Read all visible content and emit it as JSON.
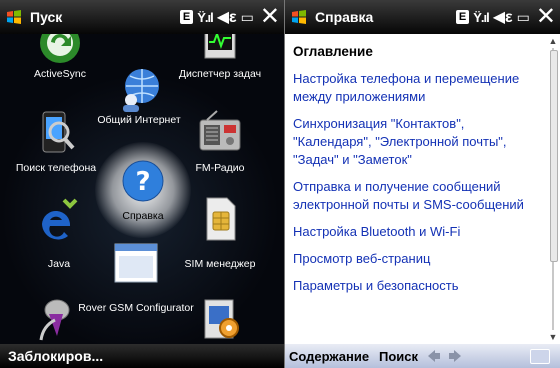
{
  "left_screen": {
    "title": "Пуск",
    "status": {
      "carrier_badge": "E",
      "close_glyph": "✕"
    },
    "apps": [
      {
        "label": "ActiveSync",
        "icon": "activesync-icon"
      },
      {
        "label": "Диспетчер задач",
        "icon": "task-manager-icon"
      },
      {
        "label": "Общий Интернет",
        "icon": "internet-sharing-icon"
      },
      {
        "label": "Поиск телефона",
        "icon": "search-phone-icon"
      },
      {
        "label": "FM-Радио",
        "icon": "fm-radio-icon"
      },
      {
        "label": "Справка",
        "icon": "help-icon"
      },
      {
        "label": "Java",
        "icon": "java-icon"
      },
      {
        "label": "SIM менеджер",
        "icon": "sim-manager-icon"
      },
      {
        "label": "Rover GSM Configurator",
        "icon": "rover-gsm-icon"
      },
      {
        "label": "",
        "icon": "microphone-icon"
      },
      {
        "label": "",
        "icon": "settings-icon"
      }
    ],
    "bottom_left": "Заблокиров..."
  },
  "right_screen": {
    "title": "Справка",
    "status": {
      "carrier_badge": "E",
      "close_glyph": "✕"
    },
    "heading": "Оглавление",
    "links": [
      "Настройка телефона и перемещение между приложениями",
      "Синхронизация \"Контактов\", \"Календаря\", \"Электронной почты\", \"Задач\" и \"Заметок\"",
      "Отправка и получение сообщений электронной почты и SMS-сообщений",
      "Настройка Bluetooth и Wi-Fi",
      "Просмотр веб-страниц",
      "Параметры и безопасность"
    ],
    "softkey_left": "Содержание",
    "softkey_right": "Поиск"
  }
}
